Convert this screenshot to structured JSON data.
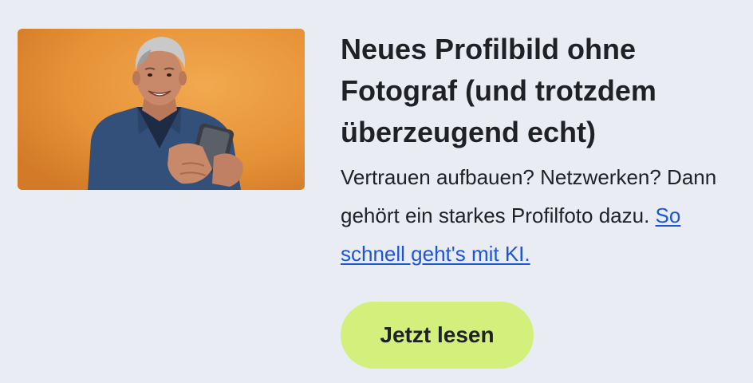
{
  "article": {
    "image_alt": "Mann mit grauen Haaren im Jeanshemd hält lächelnd ein Smartphone vor orangefarbenem Hintergrund",
    "headline": "Neues Profilbild ohne Fotograf (und trotzdem überzeugend echt)",
    "teaser_text": "Vertrauen aufbauen? Netzwerken? Dann gehört ein starkes Profilfoto dazu. ",
    "teaser_link": "So schnell geht's mit KI.",
    "cta_label": "Jetzt lesen"
  },
  "colors": {
    "background": "#e9ecf3",
    "link": "#1c56d4",
    "cta_background": "#d3f07c",
    "image_background": "#e89338"
  }
}
